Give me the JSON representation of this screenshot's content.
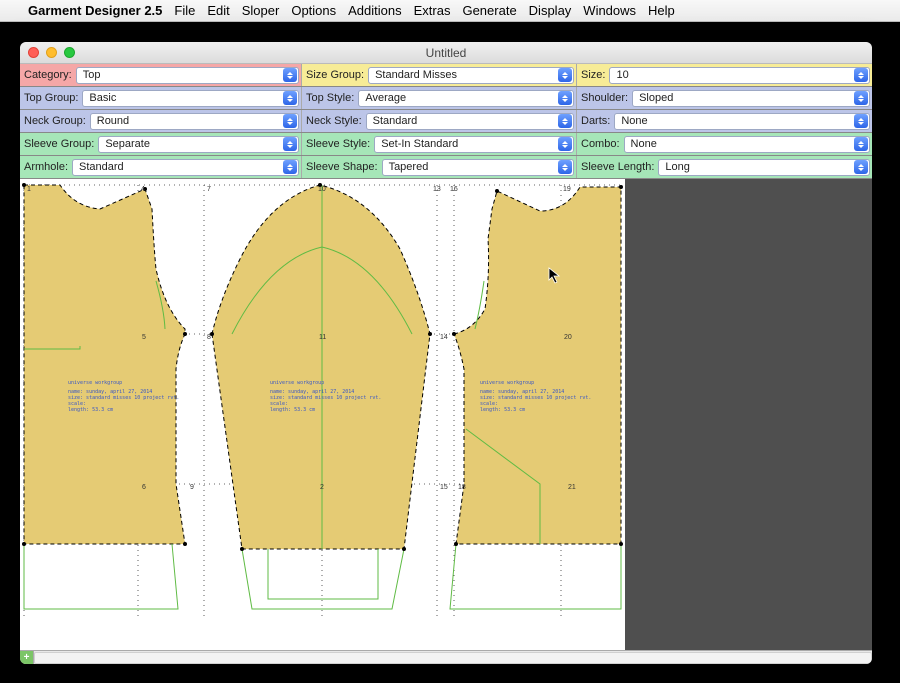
{
  "menubar": {
    "appname": "Garment Designer 2.5",
    "items": [
      "File",
      "Edit",
      "Sloper",
      "Options",
      "Additions",
      "Extras",
      "Generate",
      "Display",
      "Windows",
      "Help"
    ]
  },
  "window": {
    "title": "Untitled"
  },
  "controls": {
    "row1": {
      "category": {
        "label": "Category:",
        "value": "Top"
      },
      "sizegroup": {
        "label": "Size Group:",
        "value": "Standard Misses"
      },
      "size": {
        "label": "Size:",
        "value": "10"
      }
    },
    "row2": {
      "topgroup": {
        "label": "Top Group:",
        "value": "Basic"
      },
      "topstyle": {
        "label": "Top Style:",
        "value": "Average"
      },
      "shoulder": {
        "label": "Shoulder:",
        "value": "Sloped"
      }
    },
    "row3": {
      "neckgroup": {
        "label": "Neck Group:",
        "value": "Round"
      },
      "neckstyle": {
        "label": "Neck Style:",
        "value": "Standard"
      },
      "darts": {
        "label": "Darts:",
        "value": "None"
      }
    },
    "row4": {
      "sleevegroup": {
        "label": "Sleeve Group:",
        "value": "Separate"
      },
      "sleevestyle": {
        "label": "Sleeve Style:",
        "value": "Set-In Standard"
      },
      "combo": {
        "label": "Combo:",
        "value": "None"
      }
    },
    "row5": {
      "armhole": {
        "label": "Armhole:",
        "value": "Standard"
      },
      "sleeveshape": {
        "label": "Sleeve Shape:",
        "value": "Tapered"
      },
      "sleevelength": {
        "label": "Sleeve Length:",
        "value": "Long"
      }
    }
  },
  "canvas": {
    "markers": [
      "1",
      "4",
      "7",
      "10",
      "13",
      "16",
      "19",
      "5",
      "8",
      "11",
      "14",
      "20",
      "6",
      "9",
      "2",
      "15",
      "18",
      "21"
    ],
    "infoblock": {
      "line1": "universe workgroup",
      "line2": "name:   sunday, april 27, 2014",
      "line3": "size:   standard misses 10 project rvt.",
      "line4": "scale:",
      "line5": "length: 53.3 cm"
    }
  }
}
